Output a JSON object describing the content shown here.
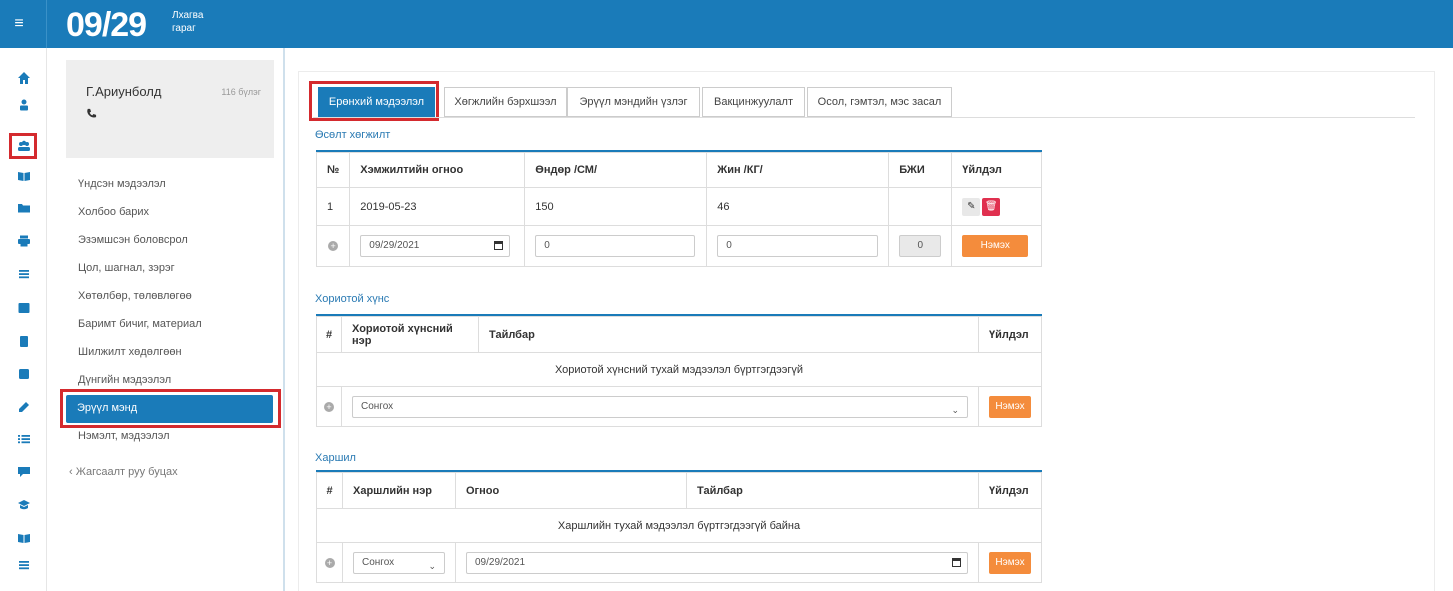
{
  "header": {
    "date": "09/29",
    "day_line1": "Лхагва",
    "day_line2": "гараг"
  },
  "rail_icons": [
    "home-icon",
    "users-icon",
    "group-icon",
    "book-icon",
    "folder-icon",
    "print-icon",
    "list-icon",
    "list-alt-icon",
    "clipboard-icon",
    "b-icon",
    "edit-icon",
    "tasks-icon",
    "chat-icon",
    "graduation-icon",
    "book-open-icon",
    "menu-icon"
  ],
  "profile": {
    "name": "Г.Ариунболд",
    "points": "116 бүлэг"
  },
  "nav": {
    "items": [
      "Үндсэн мэдээлэл",
      "Холбоо барих",
      "Эзэмшсэн боловсрол",
      "Цол, шагнал, зэрэг",
      "Хөтөлбөр, төлөвлөгөө",
      "Баримт бичиг, материал",
      "Шилжилт хөдөлгөөн",
      "Дүнгийн мэдээлэл"
    ],
    "active": "Эрүүл мэнд",
    "after": "Нэмэлт, мэдээлэл",
    "back": "‹  Жагсаалт руу буцах"
  },
  "tabs": [
    "Ерөнхий мэдээлэл",
    "Хөгжлийн бэрхшээл",
    "Эрүүл мэндийн үзлэг",
    "Вакцинжуулалт",
    "Осол, гэмтэл, мэс засал"
  ],
  "growth": {
    "title": "Өсөлт хөгжилт",
    "headers": [
      "№",
      "Хэмжилтийн огноо",
      "Өндөр /СМ/",
      "Жин /КГ/",
      "БЖИ",
      "Үйлдэл"
    ],
    "rows": [
      {
        "no": "1",
        "date": "2019-05-23",
        "height": "150",
        "weight": "46",
        "bmi": ""
      }
    ],
    "new_date": "09/29/2021",
    "new_height": "0",
    "new_weight": "0",
    "new_bmi": "0",
    "add_label": "Нэмэх"
  },
  "food": {
    "title": "Хориотой хүнс",
    "headers": [
      "#",
      "Хориотой хүнсний нэр",
      "Тайлбар",
      "Үйлдэл"
    ],
    "empty": "Хориотой хүнсний тухай мэдээлэл бүртгэгдээгүй",
    "select": "Сонгох",
    "add_label": "Нэмэх"
  },
  "allergy": {
    "title": "Харшил",
    "headers": [
      "#",
      "Харшлийн нэр",
      "Огноо",
      "Тайлбар",
      "Үйлдэл"
    ],
    "empty": "Харшлийн тухай мэдээлэл бүртгэгдээгүй байна",
    "select": "Сонгох",
    "date": "09/29/2021",
    "add_label": "Нэмэх"
  }
}
